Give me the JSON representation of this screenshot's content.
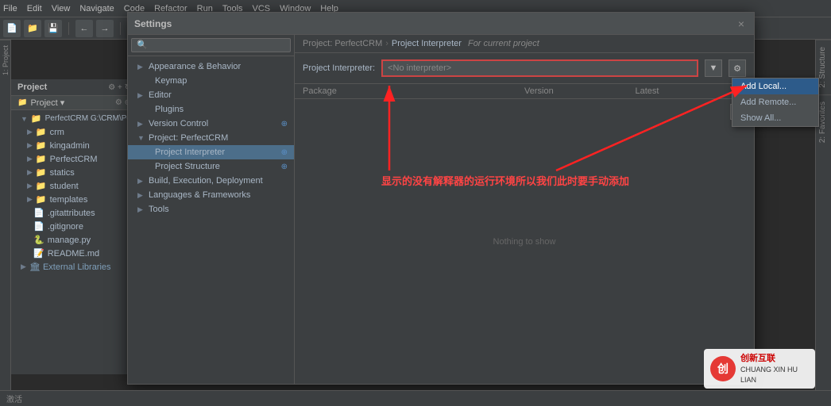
{
  "menubar": {
    "items": [
      "File",
      "Edit",
      "View",
      "Navigate",
      "Code",
      "Refactor",
      "Run",
      "Tools",
      "VCS",
      "Window",
      "Help"
    ]
  },
  "dialog": {
    "title": "Settings",
    "close_btn": "×",
    "search_placeholder": "🔍",
    "breadcrumb": {
      "root": "Project: PerfectCRM",
      "sep1": "›",
      "section": "Project Interpreter",
      "sep2": "⊕",
      "note": "For current project"
    },
    "interpreter_label": "Project Interpreter:",
    "interpreter_value": "<No interpreter>",
    "table_headers": {
      "package": "Package",
      "version": "Version",
      "latest": "Latest"
    },
    "nothing_to_show": "Nothing to show",
    "add_btn": "+",
    "settings_tree": [
      {
        "label": "▶  Appearance & Behavior",
        "level": 0,
        "expanded": false
      },
      {
        "label": "Keymap",
        "level": 1
      },
      {
        "label": "▶  Editor",
        "level": 0
      },
      {
        "label": "Plugins",
        "level": 1
      },
      {
        "label": "▶  Version Control",
        "level": 0
      },
      {
        "label": "▼  Project: PerfectCRM",
        "level": 0,
        "expanded": true
      },
      {
        "label": "Project Interpreter",
        "level": 1,
        "active": true
      },
      {
        "label": "Project Structure",
        "level": 1
      },
      {
        "label": "▶  Build, Execution, Deployment",
        "level": 0
      },
      {
        "label": "▶  Languages & Frameworks",
        "level": 0
      },
      {
        "label": "▶  Tools",
        "level": 0
      }
    ],
    "dropdown_menu": {
      "items": [
        "Add Local...",
        "Add Remote...",
        "Show All..."
      ]
    }
  },
  "project_tree": {
    "root": "PerfectCRM",
    "items": [
      {
        "label": "PerfectCRM  G:\\CRM\\Pe...",
        "type": "root",
        "indent": 0
      },
      {
        "label": "crm",
        "type": "folder",
        "indent": 1
      },
      {
        "label": "kingadmin",
        "type": "folder",
        "indent": 1
      },
      {
        "label": "PerfectCRM",
        "type": "folder",
        "indent": 1
      },
      {
        "label": "statics",
        "type": "folder",
        "indent": 1
      },
      {
        "label": "student",
        "type": "folder",
        "indent": 1
      },
      {
        "label": "templates",
        "type": "folder",
        "indent": 1
      },
      {
        "label": ".gitattributes",
        "type": "file",
        "indent": 2
      },
      {
        "label": ".gitignore",
        "type": "file",
        "indent": 2
      },
      {
        "label": "manage.py",
        "type": "py",
        "indent": 2
      },
      {
        "label": "README.md",
        "type": "md",
        "indent": 2
      },
      {
        "label": "External Libraries",
        "type": "special",
        "indent": 0
      }
    ]
  },
  "annotation": {
    "text": "显示的没有解释器的运行环境所以我们此时要手动添加"
  },
  "sidebar_label_project": "Project",
  "sidebar_label_structure": "2: Structure",
  "sidebar_label_favorites": "2: Favorites",
  "watermark": {
    "logo": "创",
    "line1": "创新互联",
    "line2": "CHUANG XIN HU LIAN"
  },
  "status_bar": {
    "left_text": "激活",
    "icon": "⚡"
  }
}
